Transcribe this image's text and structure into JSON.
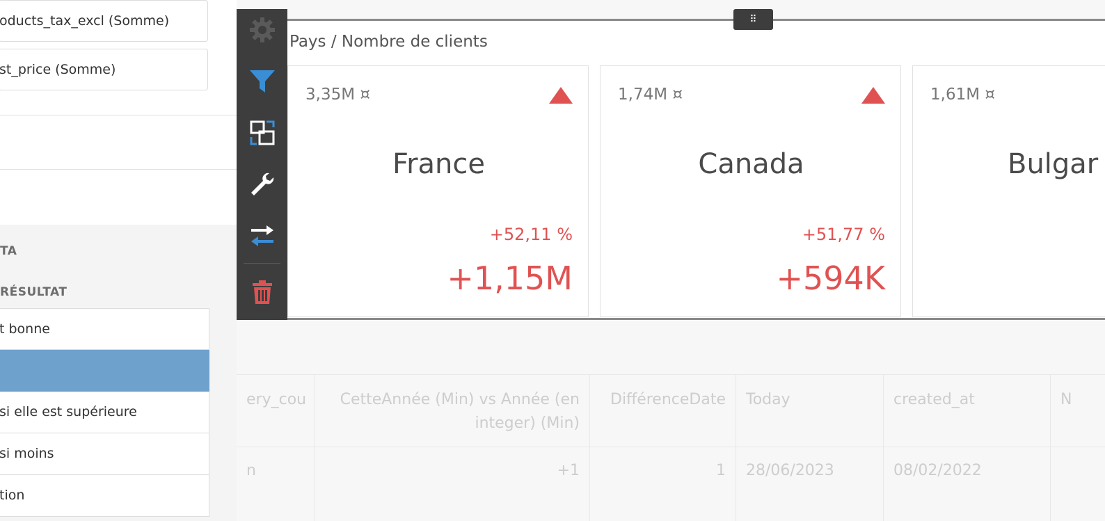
{
  "left_panel": {
    "fields": [
      "oducts_tax_excl (Somme)",
      "st_price (Somme)"
    ],
    "section_1": "TA",
    "section_2": "RÉSULTAT",
    "options": [
      "t bonne",
      "",
      " si elle est supérieure",
      " si moins",
      "tion"
    ],
    "selected_index": 1
  },
  "toolbar": {
    "icons": [
      "gear-icon",
      "filter-icon",
      "swap-panels-icon",
      "wrench-icon",
      "arrows-exchange-icon",
      "trash-icon"
    ],
    "colors": {
      "blue": "#3a8ed6",
      "red": "#e05252",
      "white": "#ffffff"
    }
  },
  "panel": {
    "title": "Pays / Nombre de clients",
    "handle_glyph": "⠿",
    "cards": [
      {
        "amount": "3,35M ¤",
        "country": "France",
        "percent": "+52,11 %",
        "delta": "+1,15M"
      },
      {
        "amount": "1,74M ¤",
        "country": "Canada",
        "percent": "+51,77 %",
        "delta": "+594K"
      },
      {
        "amount": "1,61M ¤",
        "country": "Bulgar",
        "percent": "",
        "delta": ""
      }
    ],
    "accent_color": "#e05252"
  },
  "table": {
    "headers": [
      "ery_cou",
      "CetteAnnée (Min) vs Année (en integer) (Min)",
      "DifférenceDate",
      "Today",
      "created_at",
      "N"
    ],
    "row": [
      "n",
      "+1",
      "1",
      "28/06/2023",
      "08/02/2022",
      ""
    ]
  }
}
